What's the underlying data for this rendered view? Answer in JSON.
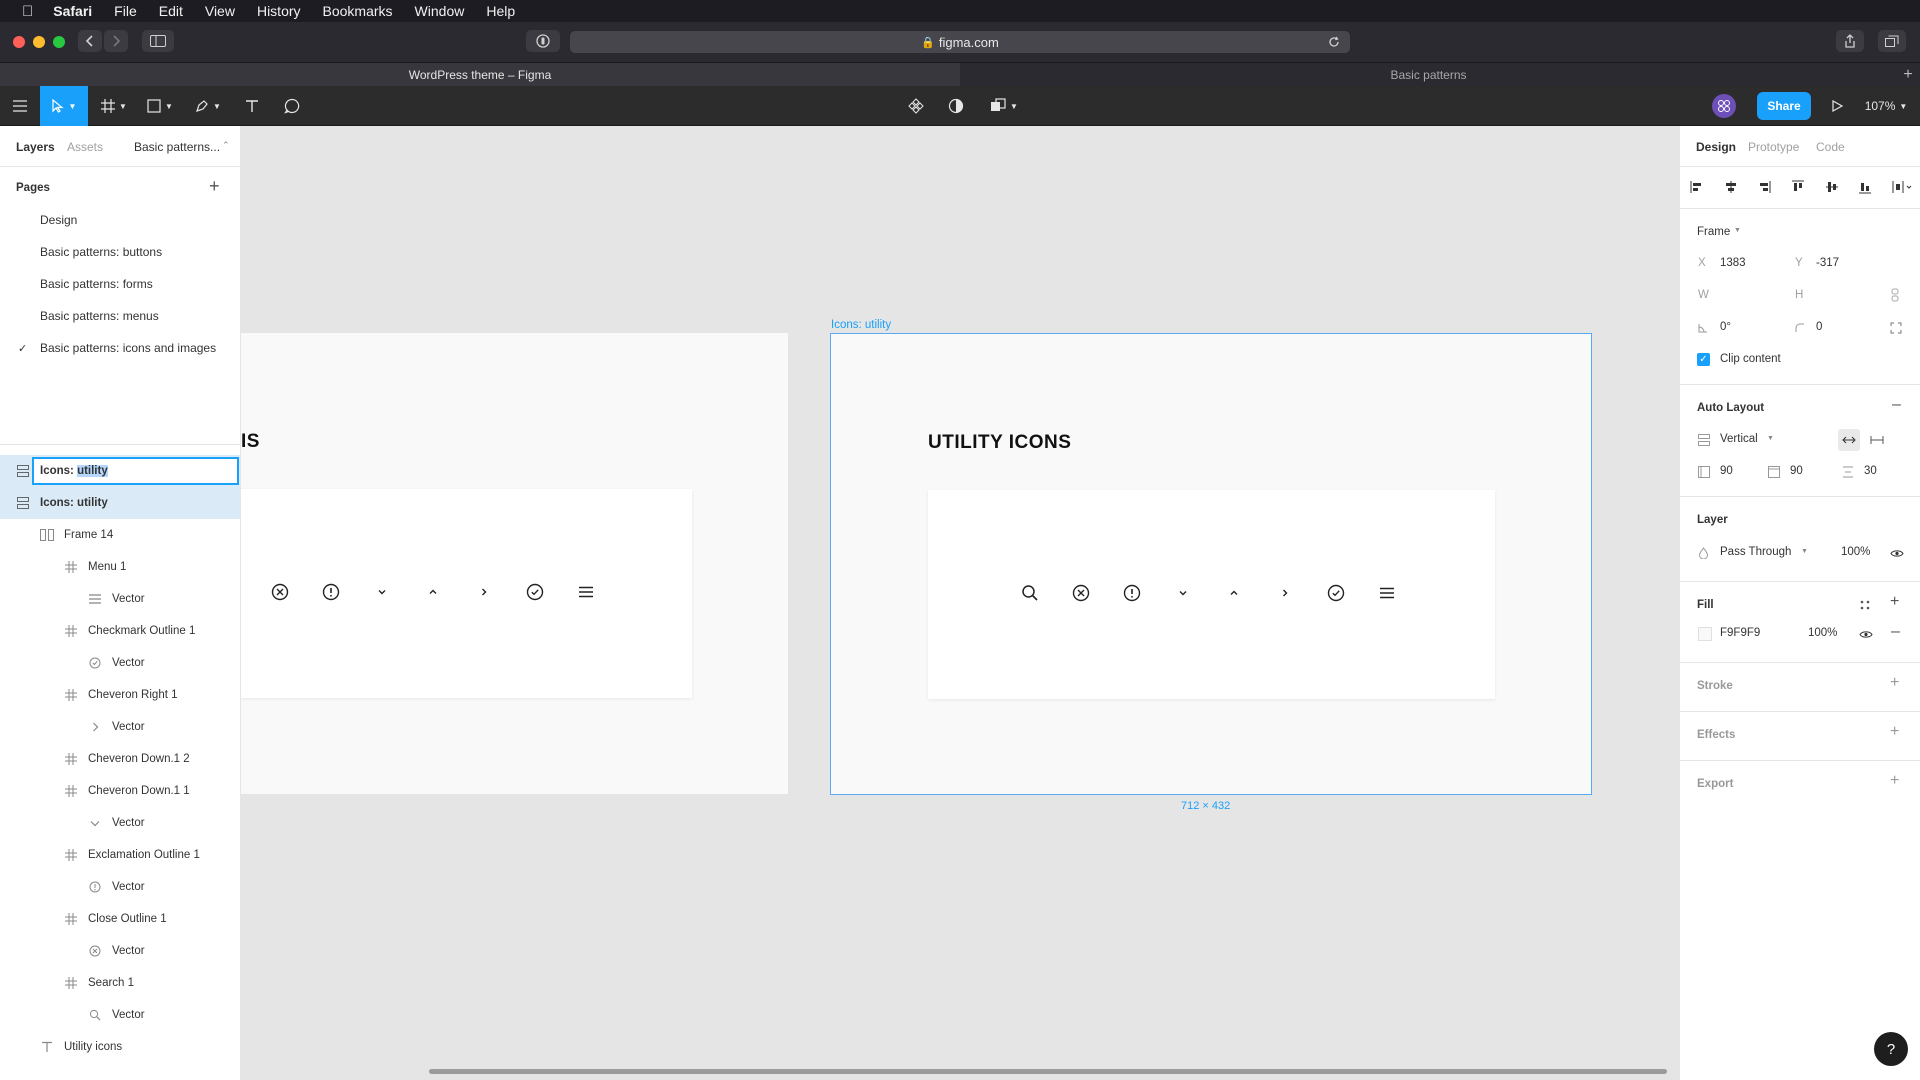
{
  "mac_menu": {
    "app": "Safari",
    "items": [
      "File",
      "Edit",
      "View",
      "History",
      "Bookmarks",
      "Window",
      "Help"
    ]
  },
  "browser": {
    "url": "figma.com",
    "tabs": [
      {
        "label": "WordPress theme – Figma",
        "active": true
      },
      {
        "label": "Basic patterns",
        "active": false
      }
    ]
  },
  "toolbar": {
    "share_label": "Share",
    "zoom": "107%"
  },
  "left_panel": {
    "tabs": {
      "layers": "Layers",
      "assets": "Assets",
      "page_switch": "Basic patterns..."
    },
    "pages_title": "Pages",
    "pages": [
      {
        "label": "Design",
        "current": false
      },
      {
        "label": "Basic patterns: buttons",
        "current": false
      },
      {
        "label": "Basic patterns: forms",
        "current": false
      },
      {
        "label": "Basic patterns: menus",
        "current": false
      },
      {
        "label": "Basic patterns: icons and images",
        "current": true
      }
    ],
    "rename_prefix": "Icons: ",
    "rename_selected": "utility",
    "layers": [
      {
        "label": "Icons: utility",
        "icon": "autolayout-icon",
        "depth": 0,
        "bold": true
      },
      {
        "label": "Frame 14",
        "icon": "frame-icon",
        "depth": 1
      },
      {
        "label": "Menu 1",
        "icon": "grid-icon",
        "depth": 2
      },
      {
        "label": "Vector",
        "icon": "menu-vector-icon",
        "depth": 3
      },
      {
        "label": "Checkmark Outline 1",
        "icon": "grid-icon",
        "depth": 2
      },
      {
        "label": "Vector",
        "icon": "check-vector-icon",
        "depth": 3
      },
      {
        "label": "Cheveron Right 1",
        "icon": "grid-icon",
        "depth": 2
      },
      {
        "label": "Vector",
        "icon": "chevron-right-vector-icon",
        "depth": 3
      },
      {
        "label": "Cheveron Down.1 2",
        "icon": "grid-icon",
        "depth": 2
      },
      {
        "label": "Cheveron Down.1 1",
        "icon": "grid-icon",
        "depth": 2
      },
      {
        "label": "Vector",
        "icon": "chevron-down-vector-icon",
        "depth": 3
      },
      {
        "label": "Exclamation Outline 1",
        "icon": "grid-icon",
        "depth": 2
      },
      {
        "label": "Vector",
        "icon": "exclamation-vector-icon",
        "depth": 3
      },
      {
        "label": "Close Outline 1",
        "icon": "grid-icon",
        "depth": 2
      },
      {
        "label": "Vector",
        "icon": "close-vector-icon",
        "depth": 3
      },
      {
        "label": "Search 1",
        "icon": "grid-icon",
        "depth": 2
      },
      {
        "label": "Vector",
        "icon": "search-vector-icon",
        "depth": 3
      },
      {
        "label": "Utility icons",
        "icon": "text-icon",
        "depth": 1
      }
    ]
  },
  "canvas": {
    "left_frame_heading_fragment": "IS",
    "frame_label": "Icons: utility",
    "frame_heading": "UTILITY ICONS",
    "frame_size": "712 × 432"
  },
  "right_panel": {
    "tabs": {
      "design": "Design",
      "prototype": "Prototype",
      "code": "Code"
    },
    "frame_title": "Frame",
    "x_label": "X",
    "x": "1383",
    "y_label": "Y",
    "y": "-317",
    "w_label": "W",
    "h_label": "H",
    "rotation": "0°",
    "radius": "0",
    "clip_content": "Clip content",
    "auto_layout": {
      "title": "Auto Layout",
      "direction": "Vertical",
      "padding_h": "90",
      "padding_v": "90",
      "spacing": "30"
    },
    "layer": {
      "title": "Layer",
      "blend": "Pass Through",
      "opacity": "100%"
    },
    "fill": {
      "title": "Fill",
      "hex": "F9F9F9",
      "opacity": "100%",
      "color": "#F9F9F9"
    },
    "stroke_title": "Stroke",
    "effects_title": "Effects",
    "export_title": "Export"
  },
  "colors": {
    "accent": "#18A0FB",
    "selection": "#5BA8F5"
  }
}
